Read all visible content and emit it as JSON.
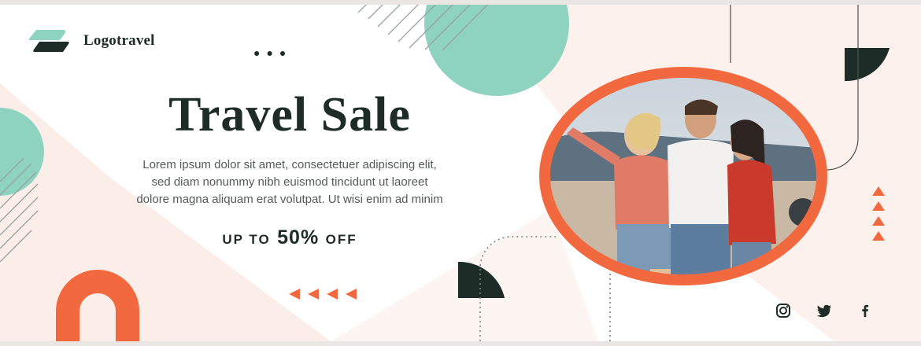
{
  "brand": {
    "name": "Logotravel",
    "logo_icon": "logo-mark"
  },
  "hero": {
    "title": "Travel Sale",
    "body_lines": [
      "Lorem ipsum dolor sit amet, consectetuer adipiscing elit,",
      "sed diam nonummy nibh euismod tincidunt ut laoreet",
      "dolore magna aliquam erat volutpat. Ut wisi enim ad minim"
    ],
    "offer": {
      "prefix": "UP TO",
      "amount": "50%",
      "suffix": "OFF"
    }
  },
  "photo": {
    "description_icon": "travel-group-photo"
  },
  "social": {
    "icons": [
      "instagram-icon",
      "twitter-icon",
      "facebook-icon"
    ]
  },
  "colors": {
    "mint": "#8ed3c0",
    "coral": "#f2693f",
    "dark": "#1e2c27",
    "blush": "#fbeee9"
  }
}
